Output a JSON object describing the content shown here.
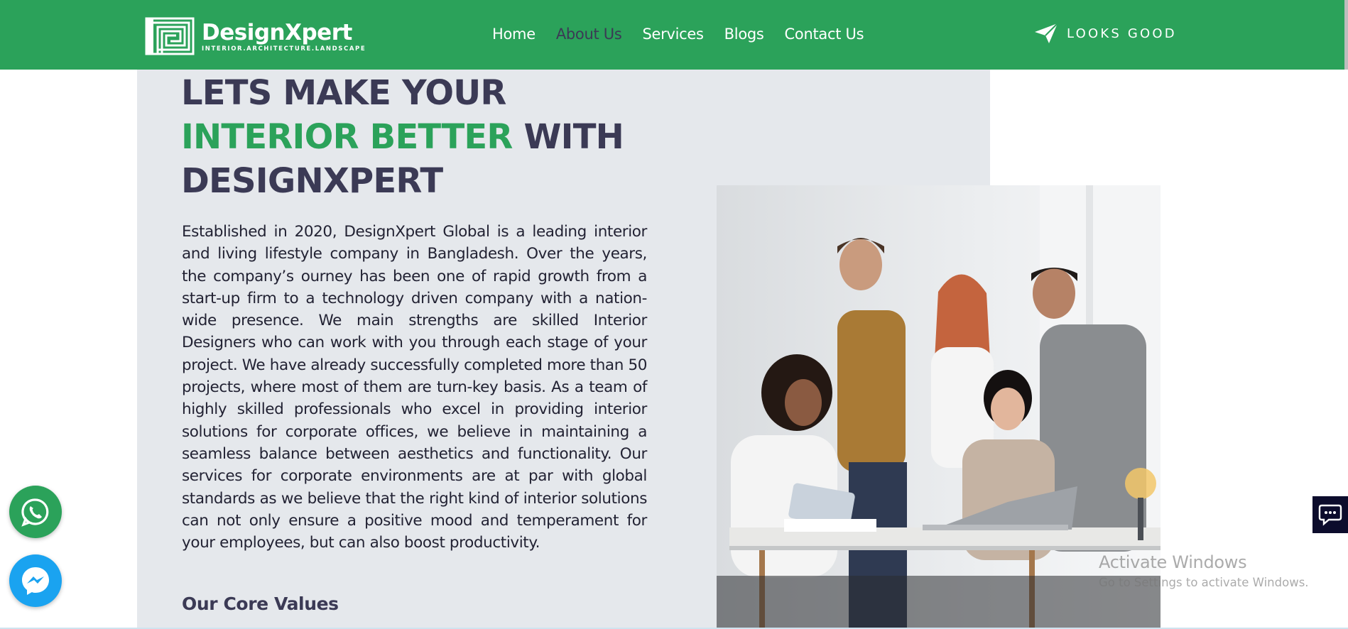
{
  "brand": {
    "name": "DesignXpert",
    "tagline": "INTERIOR.ARCHITECTURE.LANDSCAPE",
    "color": "#2ba25a",
    "logo_icon": "logo-square-maze-icon"
  },
  "nav": {
    "items": [
      {
        "label": "Home",
        "active": false
      },
      {
        "label": "About Us",
        "active": true
      },
      {
        "label": "Services",
        "active": false
      },
      {
        "label": "Blogs",
        "active": false
      },
      {
        "label": "Contact Us",
        "active": false
      }
    ]
  },
  "cta": {
    "label": "LOOKS GOOD",
    "icon": "paper-plane-icon"
  },
  "hero": {
    "line1": "LETS MAKE YOUR",
    "line2_highlight": "INTERIOR BETTER",
    "line2_rest": " WITH",
    "line3": "DESIGNXPERT",
    "body": "Established in 2020, DesignXpert Global is a leading interior and living lifestyle company in Bangladesh. Over the years, the company’s ourney has been one of rapid growth from a start-up firm to a technology driven company with a nation-wide presence. We main strengths are skilled Interior Designers who can work with you through each stage of your project. We have already successfully completed more than 50 projects, where most of them are turn-key basis. As a team of highly skilled professionals who excel in providing interior solutions for corporate offices, we believe in maintaining a seamless balance between aesthetics and functionality. Our services for corporate environments are at par with global standards as we believe that the right kind of interior solutions can not only ensure a positive mood and temperament for your employees, but can also boost productivity.",
    "core_values_heading": "Our Core Values"
  },
  "floating": {
    "whatsapp_icon": "whatsapp-icon",
    "messenger_icon": "messenger-icon",
    "chat_icon": "chat-bubble-icon"
  },
  "watermark": {
    "title": "Activate Windows",
    "subtitle": "Go to Settings to activate Windows."
  }
}
